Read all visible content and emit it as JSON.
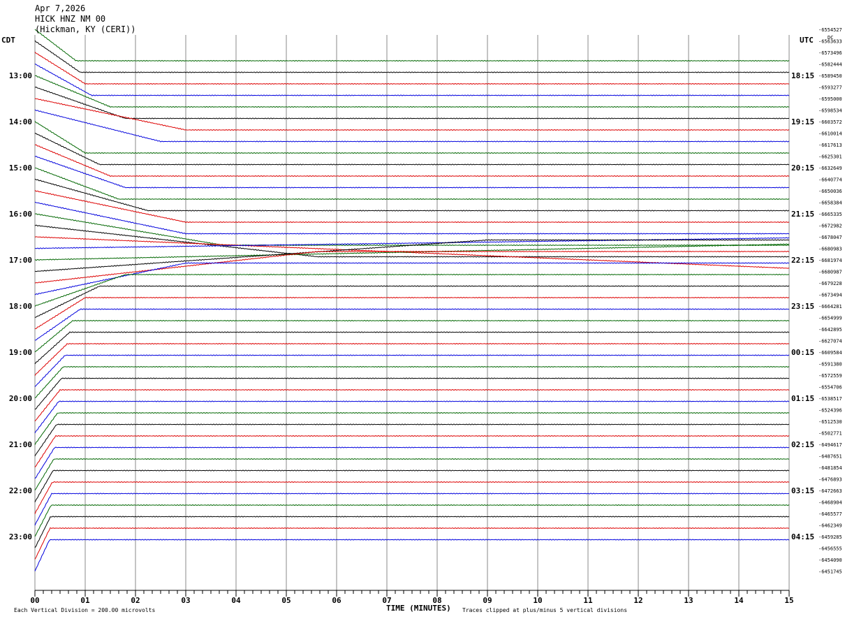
{
  "header": {
    "date": "Apr 7,2026",
    "station": "HICK HNZ NM 00",
    "location": "(Hickman, KY (CERI))"
  },
  "axis": {
    "left_label": "CDT",
    "right_label": "UTC",
    "dc_label": "DC",
    "xlabel": "TIME (MINUTES)",
    "x_ticks": [
      "00",
      "01",
      "02",
      "03",
      "04",
      "05",
      "06",
      "07",
      "08",
      "09",
      "10",
      "11",
      "12",
      "13",
      "14",
      "15"
    ],
    "left_hours": [
      "13:00",
      "14:00",
      "15:00",
      "16:00",
      "17:00",
      "18:00",
      "19:00",
      "20:00",
      "21:00",
      "22:00",
      "23:00"
    ],
    "right_hours": [
      "18:15",
      "19:15",
      "20:15",
      "21:15",
      "22:15",
      "23:15",
      "00:15",
      "01:15",
      "02:15",
      "03:15",
      "04:15"
    ]
  },
  "footer": {
    "scale_note": "Each Vertical Division =  200.00 microvolts",
    "clip_note": "Traces clipped at plus/minus 5 vertical divisions"
  },
  "colors": {
    "black": "#000000",
    "red": "#dd0000",
    "blue": "#0000dd",
    "green": "#006600",
    "grid": "#888888"
  },
  "chart_data": {
    "type": "line",
    "xlabel": "TIME (MINUTES)",
    "xlim": [
      0,
      15
    ],
    "color_cycle": [
      "#dd0000",
      "#0000dd",
      "#006600",
      "#000000"
    ],
    "first_trace_color_index": 2,
    "dc_offsets": [
      "-6554527",
      "-6563633",
      "-6573496",
      "-6582444",
      "-6589450",
      "-6593277",
      "-6595000",
      "-6598534",
      "-6603572",
      "-6610014",
      "-6617613",
      "-6625301",
      "-6632649",
      "-6640774",
      "-6650036",
      "-6658384",
      "-6665335",
      "-6672982",
      "-6678047",
      "-6680983",
      "-6681974",
      "-6680987",
      "-6679228",
      "-6673494",
      "-6664281",
      "-6654999",
      "-6642895",
      "-6627074",
      "-6609584",
      "-6591380",
      "-6572559",
      "-6554706",
      "-6538517",
      "-6524396",
      "-6512530",
      "-6502771",
      "-6494617",
      "-6487651",
      "-6481854",
      "-6476893",
      "-6472663",
      "-6468904",
      "-6465577",
      "-6462349",
      "-6459285",
      "-6456555",
      "-6454090",
      "-6451745"
    ],
    "trace_slopes": [
      -5.5,
      -5,
      -4.5,
      -4,
      -3,
      -2.5,
      -1.5,
      -1.8,
      -4.5,
      -3.5,
      -3,
      -2.5,
      -2.7,
      -2,
      -1.5,
      -1.5,
      -1.2,
      -0.8,
      -0.3,
      0.1,
      0.15,
      0.5,
      0.8,
      1.5,
      2.5,
      3.5,
      4.5,
      5,
      6,
      6.5,
      7,
      7.5,
      8,
      8.5,
      9,
      9.5,
      10,
      10.5,
      11,
      11.5,
      12,
      12.5,
      13,
      13.5,
      14,
      14.5,
      15,
      15.5
    ]
  }
}
